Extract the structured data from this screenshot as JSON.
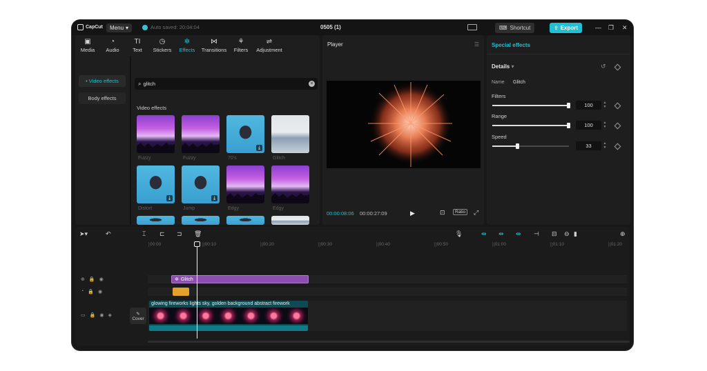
{
  "app": {
    "logo_text": "CapCut",
    "menu_label": "Menu",
    "autosave_text": "Auto saved: 20:04:04",
    "project_title": "0505 (1)",
    "shortcut_label": "Shortcut",
    "export_label": "Export"
  },
  "toolbar": {
    "items": [
      {
        "label": "Media",
        "icon": "media-icon"
      },
      {
        "label": "Audio",
        "icon": "audio-icon"
      },
      {
        "label": "Text",
        "icon": "text-icon"
      },
      {
        "label": "Stickers",
        "icon": "stickers-icon"
      },
      {
        "label": "Effects",
        "icon": "effects-icon",
        "active": true
      },
      {
        "label": "Transitions",
        "icon": "transitions-icon"
      },
      {
        "label": "Filters",
        "icon": "filters-icon"
      },
      {
        "label": "Adjustment",
        "icon": "adjustment-icon"
      }
    ]
  },
  "categories": {
    "video_effects": "• Video effects",
    "body_effects": "Body effects"
  },
  "search": {
    "value": "glitch"
  },
  "effects": {
    "section_label": "Video effects",
    "items": [
      {
        "label": "Fuzzy"
      },
      {
        "label": "Fuzzy"
      },
      {
        "label": "70's"
      },
      {
        "label": "Glitch"
      },
      {
        "label": "Distort"
      },
      {
        "label": "Jump"
      },
      {
        "label": "Edgy"
      },
      {
        "label": "Edgy"
      }
    ]
  },
  "player": {
    "title": "Player",
    "current_time": "00:00:08:06",
    "total_time": "00:00:27:09",
    "ratio_label": "Ratio"
  },
  "inspector": {
    "tab": "Special effects",
    "details_label": "Details",
    "name_key": "Name",
    "name_value": "Glitch",
    "filters_label": "Filters",
    "filters_value": "100",
    "filters_level": 1.0,
    "range_label": "Range",
    "range_value": "100",
    "range_level": 1.0,
    "speed_label": "Speed",
    "speed_value": "33",
    "speed_level": 0.33
  },
  "timeline": {
    "ruler": [
      "00:00",
      "|00:10",
      "|00:20",
      "|00:30",
      "|00:40",
      "|00:50",
      "|01:00",
      "|01:10",
      "|01:20"
    ],
    "effect_clip_label": "Glitch",
    "video_clip_label": "glowing fireworks lights sky, golden background abstract firework",
    "cover_label": "Cover"
  },
  "colors": {
    "accent": "#1fc0d4",
    "effect_clip": "#8c4fb0",
    "orange_clip": "#e3a02a",
    "video_clip": "#0e4a52"
  }
}
